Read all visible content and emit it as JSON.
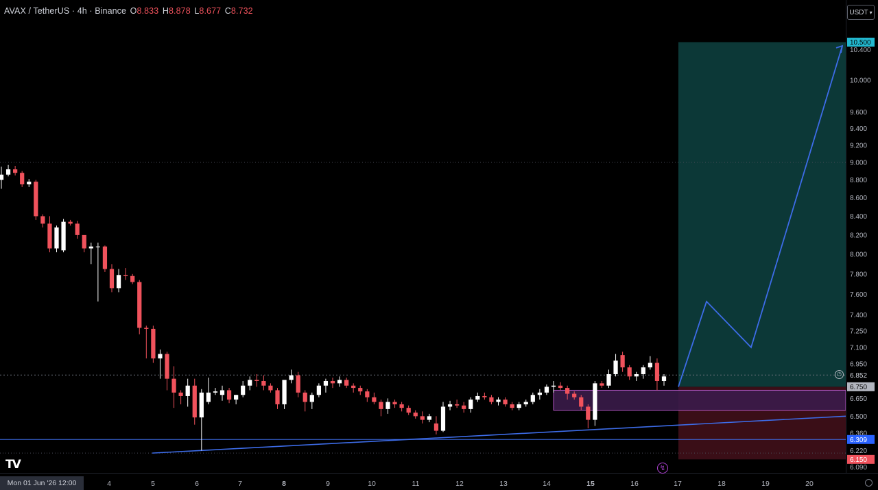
{
  "header": {
    "symbol": "AVAX / TetherUS · 4h · Binance",
    "o_label": "O",
    "o_value": "8.833",
    "h_label": "H",
    "h_value": "8.878",
    "l_label": "L",
    "l_value": "8.677",
    "c_label": "C",
    "c_value": "8.732"
  },
  "currency_button": {
    "label": "USDT",
    "icon": "chevron-down-icon"
  },
  "logo": {
    "text": "TV"
  },
  "cursor_date": "Mon 01 Jun '26   12:00",
  "icons": {
    "bolt": "bolt-icon",
    "settings": "settings-icon",
    "alert": "alert-clock-icon"
  },
  "colors": {
    "background": "#000000",
    "up_candle": "#ffffff",
    "down_candle": "#f0525c",
    "trendline": "#3d6ce8",
    "target_zone": "#0d3b3a",
    "stop_zone": "#3d0f18",
    "range_box": "#3a1b4a",
    "range_box_border": "#c25fd6",
    "target_label": "#22b8cf",
    "support_label": "#2962ff",
    "stop_label": "#f0525c",
    "entry_label": "#b2b5be",
    "current_label": "#d1d4dc"
  },
  "chart_data": {
    "type": "candlestick",
    "symbol": "AVAX/USDT",
    "timeframe": "4h",
    "exchange": "Binance",
    "y_range": [
      6.05,
      10.7
    ],
    "y_scale": "log",
    "y_ticks": [
      "10.400",
      "10.000",
      "9.600",
      "9.400",
      "9.200",
      "9.000",
      "8.800",
      "8.600",
      "8.400",
      "8.200",
      "8.000",
      "7.800",
      "7.600",
      "7.400",
      "7.250",
      "7.100",
      "6.950",
      "6.650",
      "6.500",
      "6.360",
      "6.220",
      "6.090"
    ],
    "x_ticks": [
      "4",
      "5",
      "6",
      "7",
      "8",
      "9",
      "10",
      "11",
      "12",
      "13",
      "14",
      "15",
      "16",
      "17",
      "18",
      "19",
      "20"
    ],
    "x_tick_bold": [
      "8",
      "15"
    ],
    "price_labels": {
      "target": "10.500",
      "current": "6.852",
      "entry": "6.750",
      "support": "6.309",
      "stop": "6.150"
    },
    "candles": [
      [
        8.8,
        8.95,
        8.7,
        8.86
      ],
      [
        8.86,
        8.97,
        8.84,
        8.92
      ],
      [
        8.92,
        8.96,
        8.85,
        8.88
      ],
      [
        8.88,
        8.9,
        8.72,
        8.75
      ],
      [
        8.75,
        8.81,
        8.72,
        8.78
      ],
      [
        8.78,
        8.8,
        8.36,
        8.4
      ],
      [
        8.4,
        8.42,
        8.28,
        8.32
      ],
      [
        8.32,
        8.4,
        8.02,
        8.06
      ],
      [
        8.06,
        8.3,
        8.02,
        8.28
      ],
      [
        8.04,
        8.37,
        8.02,
        8.34
      ],
      [
        8.34,
        8.36,
        8.3,
        8.32
      ],
      [
        8.32,
        8.35,
        8.16,
        8.2
      ],
      [
        8.2,
        8.1,
        8.02,
        8.06
      ],
      [
        8.06,
        8.12,
        7.9,
        8.08
      ],
      [
        8.08,
        8.12,
        7.53,
        8.08
      ],
      [
        8.08,
        8.09,
        7.82,
        7.85
      ],
      [
        7.85,
        7.9,
        7.62,
        7.66
      ],
      [
        7.66,
        7.85,
        7.62,
        7.79
      ],
      [
        7.79,
        7.86,
        7.74,
        7.78
      ],
      [
        7.78,
        7.8,
        7.7,
        7.72
      ],
      [
        7.72,
        7.74,
        7.22,
        7.28
      ],
      [
        7.28,
        7.3,
        7.0,
        7.27
      ],
      [
        7.27,
        7.3,
        6.96,
        7.0
      ],
      [
        7.0,
        7.08,
        6.82,
        7.04
      ],
      [
        7.04,
        7.06,
        6.72,
        6.82
      ],
      [
        6.82,
        6.93,
        6.57,
        6.7
      ],
      [
        6.7,
        6.72,
        6.6,
        6.67
      ],
      [
        6.67,
        6.82,
        6.58,
        6.76
      ],
      [
        6.76,
        6.82,
        6.43,
        6.49
      ],
      [
        6.49,
        6.73,
        6.22,
        6.7
      ],
      [
        6.62,
        6.83,
        6.6,
        6.7
      ],
      [
        6.7,
        6.74,
        6.68,
        6.71
      ],
      [
        6.68,
        6.76,
        6.63,
        6.72
      ],
      [
        6.72,
        6.74,
        6.61,
        6.64
      ],
      [
        6.64,
        6.68,
        6.6,
        6.68
      ],
      [
        6.68,
        6.8,
        6.66,
        6.76
      ],
      [
        6.76,
        6.84,
        6.72,
        6.81
      ],
      [
        6.81,
        6.86,
        6.75,
        6.8
      ],
      [
        6.8,
        6.85,
        6.72,
        6.76
      ],
      [
        6.76,
        6.78,
        6.7,
        6.72
      ],
      [
        6.72,
        6.74,
        6.56,
        6.6
      ],
      [
        6.6,
        6.78,
        6.56,
        6.81
      ],
      [
        6.81,
        6.9,
        6.78,
        6.85
      ],
      [
        6.85,
        6.88,
        6.66,
        6.7
      ],
      [
        6.7,
        6.72,
        6.54,
        6.62
      ],
      [
        6.62,
        6.7,
        6.56,
        6.68
      ],
      [
        6.68,
        6.78,
        6.66,
        6.76
      ],
      [
        6.76,
        6.82,
        6.7,
        6.8
      ],
      [
        6.8,
        6.83,
        6.74,
        6.78
      ],
      [
        6.78,
        6.84,
        6.75,
        6.81
      ],
      [
        6.81,
        6.83,
        6.74,
        6.76
      ],
      [
        6.76,
        6.78,
        6.7,
        6.74
      ],
      [
        6.74,
        6.76,
        6.68,
        6.71
      ],
      [
        6.71,
        6.73,
        6.62,
        6.66
      ],
      [
        6.66,
        6.7,
        6.6,
        6.62
      ],
      [
        6.62,
        6.64,
        6.5,
        6.56
      ],
      [
        6.56,
        6.65,
        6.52,
        6.62
      ],
      [
        6.62,
        6.64,
        6.57,
        6.6
      ],
      [
        6.6,
        6.62,
        6.54,
        6.57
      ],
      [
        6.57,
        6.59,
        6.51,
        6.53
      ],
      [
        6.53,
        6.55,
        6.48,
        6.5
      ],
      [
        6.5,
        6.54,
        6.44,
        6.47
      ],
      [
        6.47,
        6.52,
        6.45,
        6.5
      ],
      [
        6.44,
        6.5,
        6.35,
        6.38
      ],
      [
        6.38,
        6.62,
        6.37,
        6.58
      ],
      [
        6.58,
        6.63,
        6.55,
        6.6
      ],
      [
        6.6,
        6.64,
        6.57,
        6.59
      ],
      [
        6.59,
        6.62,
        6.53,
        6.56
      ],
      [
        6.56,
        6.66,
        6.53,
        6.64
      ],
      [
        6.64,
        6.7,
        6.62,
        6.67
      ],
      [
        6.67,
        6.7,
        6.64,
        6.66
      ],
      [
        6.66,
        6.68,
        6.6,
        6.62
      ],
      [
        6.62,
        6.66,
        6.59,
        6.64
      ],
      [
        6.64,
        6.66,
        6.58,
        6.6
      ],
      [
        6.6,
        6.62,
        6.55,
        6.57
      ],
      [
        6.57,
        6.62,
        6.55,
        6.6
      ],
      [
        6.6,
        6.64,
        6.58,
        6.62
      ],
      [
        6.62,
        6.7,
        6.6,
        6.68
      ],
      [
        6.68,
        6.73,
        6.64,
        6.7
      ],
      [
        6.7,
        6.77,
        6.68,
        6.75
      ],
      [
        6.75,
        6.8,
        6.7,
        6.76
      ],
      [
        6.76,
        6.79,
        6.72,
        6.74
      ],
      [
        6.74,
        6.76,
        6.64,
        6.69
      ],
      [
        6.69,
        6.71,
        6.64,
        6.66
      ],
      [
        6.66,
        6.68,
        6.55,
        6.58
      ],
      [
        6.58,
        6.6,
        6.4,
        6.47
      ],
      [
        6.47,
        6.8,
        6.42,
        6.78
      ],
      [
        6.78,
        6.8,
        6.74,
        6.76
      ],
      [
        6.76,
        6.9,
        6.74,
        6.86
      ],
      [
        6.86,
        7.04,
        6.84,
        6.98
      ],
      [
        7.03,
        7.06,
        6.88,
        6.92
      ],
      [
        6.92,
        6.94,
        6.81,
        6.84
      ],
      [
        6.84,
        6.88,
        6.8,
        6.86
      ],
      [
        6.86,
        6.94,
        6.82,
        6.92
      ],
      [
        6.92,
        7.02,
        6.9,
        6.96
      ],
      [
        6.96,
        7.0,
        6.72,
        6.8
      ],
      [
        6.8,
        6.86,
        6.76,
        6.84
      ]
    ],
    "trendline": {
      "from_price": 6.2,
      "to_price": 6.5
    },
    "support_level": 6.309,
    "current_level": 6.852,
    "dotted_level": 9.0,
    "range_box": {
      "top": 6.72,
      "bottom": 6.55
    },
    "long_position": {
      "entry": 6.75,
      "target": 10.5,
      "stop": 6.15
    },
    "projection_path": [
      6.75,
      7.53,
      7.1,
      10.45
    ]
  }
}
